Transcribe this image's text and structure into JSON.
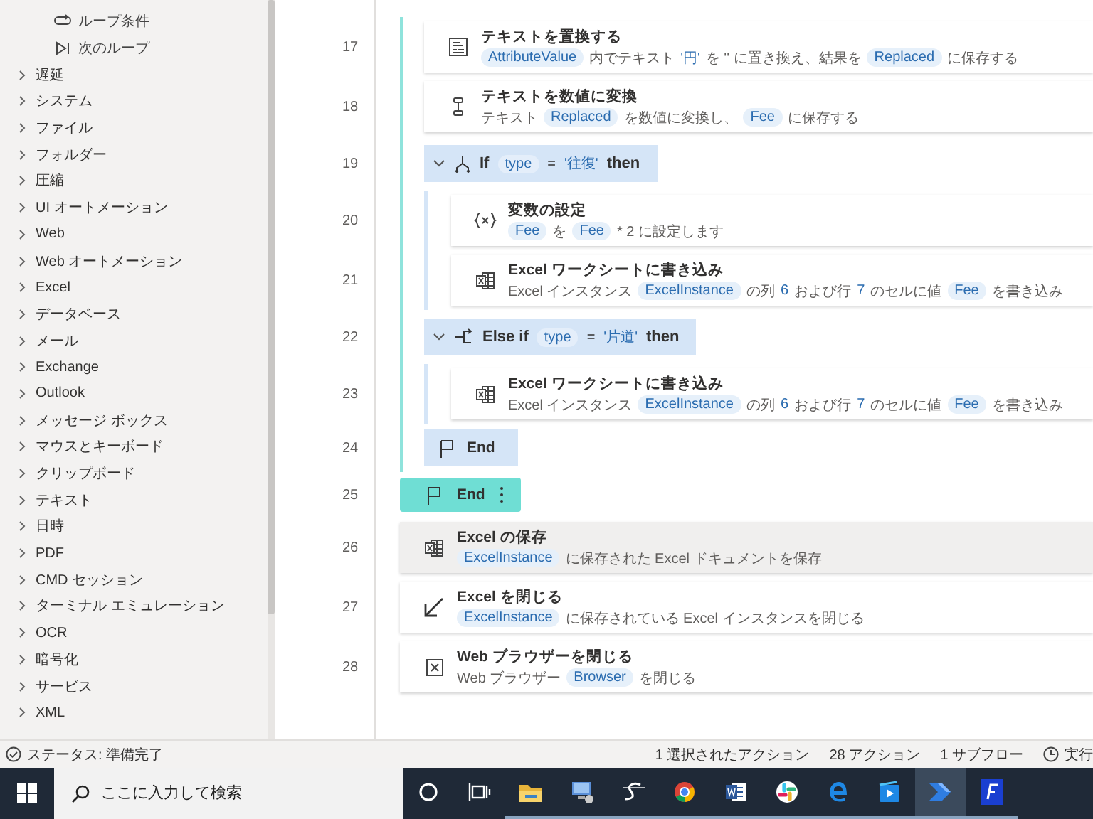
{
  "sidebar": {
    "items": [
      {
        "kind": "condition",
        "label": "ループ条件"
      },
      {
        "kind": "next",
        "label": "次のループ"
      },
      {
        "kind": "group",
        "label": "遅延",
        "expanded": false
      },
      {
        "kind": "group",
        "label": "システム",
        "expanded": false
      },
      {
        "kind": "group",
        "label": "ファイル",
        "expanded": false
      },
      {
        "kind": "group",
        "label": "フォルダー",
        "expanded": false
      },
      {
        "kind": "group",
        "label": "圧縮",
        "expanded": false
      },
      {
        "kind": "group",
        "label": "UI オートメーション",
        "expanded": false
      },
      {
        "kind": "group",
        "label": "Web",
        "expanded": false
      },
      {
        "kind": "group",
        "label": "Web オートメーション",
        "expanded": false
      },
      {
        "kind": "group",
        "label": "Excel",
        "expanded": false
      },
      {
        "kind": "group",
        "label": "データベース",
        "expanded": false
      },
      {
        "kind": "group",
        "label": "メール",
        "expanded": false
      },
      {
        "kind": "group",
        "label": "Exchange",
        "expanded": false
      },
      {
        "kind": "group",
        "label": "Outlook",
        "expanded": false
      },
      {
        "kind": "group",
        "label": "メッセージ ボックス",
        "expanded": false
      },
      {
        "kind": "group",
        "label": "マウスとキーボード",
        "expanded": false
      },
      {
        "kind": "group",
        "label": "クリップボード",
        "expanded": false
      },
      {
        "kind": "group",
        "label": "テキスト",
        "expanded": false
      },
      {
        "kind": "group",
        "label": "日時",
        "expanded": false
      },
      {
        "kind": "group",
        "label": "PDF",
        "expanded": false
      },
      {
        "kind": "group",
        "label": "CMD セッション",
        "expanded": false
      },
      {
        "kind": "group",
        "label": "ターミナル エミュレーション",
        "expanded": false
      },
      {
        "kind": "group",
        "label": "OCR",
        "expanded": false
      },
      {
        "kind": "group",
        "label": "暗号化",
        "expanded": false
      },
      {
        "kind": "group",
        "label": "サービス",
        "expanded": false
      },
      {
        "kind": "group",
        "label": "XML",
        "expanded": false
      }
    ]
  },
  "flow": {
    "steps": [
      {
        "kind": "loop",
        "children": [
          {
            "kind": "replace",
            "number": "17",
            "title": "テキストを置換する",
            "selected": false,
            "hovered": false,
            "description": [
              {
                "kind": "var",
                "text": "AttributeValue"
              },
              {
                "kind": "text",
                "text": "内でテキスト"
              },
              {
                "kind": "literal",
                "text": "'円'"
              },
              {
                "kind": "text",
                "text": "を '' に置き換え、結果を"
              },
              {
                "kind": "var",
                "text": "Replaced"
              },
              {
                "kind": "text",
                "text": "に保存する"
              }
            ]
          },
          {
            "kind": "convert",
            "number": "18",
            "title": "テキストを数値に変換",
            "selected": false,
            "hovered": false,
            "description": [
              {
                "kind": "text",
                "text": "テキスト"
              },
              {
                "kind": "var",
                "text": "Replaced"
              },
              {
                "kind": "text",
                "text": "を数値に変換し、"
              },
              {
                "kind": "var",
                "text": "Fee"
              },
              {
                "kind": "text",
                "text": "に保存する"
              }
            ]
          },
          {
            "kind": "if",
            "number": "19",
            "expanded": true,
            "selected": false,
            "header": [
              {
                "kind": "keyword",
                "text": "If"
              },
              {
                "kind": "var",
                "text": "type"
              },
              {
                "kind": "text",
                "text": "="
              },
              {
                "kind": "literal",
                "text": "'往復'"
              },
              {
                "kind": "keyword",
                "text": "then"
              }
            ],
            "children": [
              {
                "kind": "variable",
                "number": "20",
                "title": "変数の設定",
                "selected": false,
                "hovered": false,
                "description": [
                  {
                    "kind": "var",
                    "text": "Fee"
                  },
                  {
                    "kind": "text",
                    "text": "を"
                  },
                  {
                    "kind": "var",
                    "text": "Fee"
                  },
                  {
                    "kind": "text",
                    "text": "* 2 に設定します"
                  }
                ]
              },
              {
                "kind": "excel",
                "number": "21",
                "title": "Excel ワークシートに書き込み",
                "selected": false,
                "hovered": false,
                "description": [
                  {
                    "kind": "text",
                    "text": "Excel インスタンス"
                  },
                  {
                    "kind": "var",
                    "text": "ExcelInstance"
                  },
                  {
                    "kind": "text",
                    "text": "の列"
                  },
                  {
                    "kind": "literal",
                    "text": "6"
                  },
                  {
                    "kind": "text",
                    "text": "および行"
                  },
                  {
                    "kind": "literal",
                    "text": "7"
                  },
                  {
                    "kind": "text",
                    "text": "のセルに値"
                  },
                  {
                    "kind": "var",
                    "text": "Fee"
                  },
                  {
                    "kind": "text",
                    "text": "を書き込み"
                  }
                ]
              }
            ]
          },
          {
            "kind": "elseif",
            "number": "22",
            "expanded": true,
            "selected": false,
            "header": [
              {
                "kind": "keyword",
                "text": "Else if"
              },
              {
                "kind": "var",
                "text": "type"
              },
              {
                "kind": "text",
                "text": "="
              },
              {
                "kind": "literal",
                "text": "'片道'"
              },
              {
                "kind": "keyword",
                "text": "then"
              }
            ],
            "children": [
              {
                "kind": "excel",
                "number": "23",
                "title": "Excel ワークシートに書き込み",
                "selected": false,
                "hovered": false,
                "description": [
                  {
                    "kind": "text",
                    "text": "Excel インスタンス"
                  },
                  {
                    "kind": "var",
                    "text": "ExcelInstance"
                  },
                  {
                    "kind": "text",
                    "text": "の列"
                  },
                  {
                    "kind": "literal",
                    "text": "6"
                  },
                  {
                    "kind": "text",
                    "text": "および行"
                  },
                  {
                    "kind": "literal",
                    "text": "7"
                  },
                  {
                    "kind": "text",
                    "text": "のセルに値"
                  },
                  {
                    "kind": "var",
                    "text": "Fee"
                  },
                  {
                    "kind": "text",
                    "text": "を書き込み"
                  }
                ]
              }
            ]
          },
          {
            "kind": "end",
            "number": "24",
            "label": "End",
            "selected": false
          }
        ]
      },
      {
        "kind": "loop-end",
        "number": "25",
        "label": "End",
        "selected": true
      },
      {
        "kind": "excel",
        "number": "26",
        "title": "Excel の保存",
        "selected": false,
        "hovered": true,
        "description": [
          {
            "kind": "var",
            "text": "ExcelInstance"
          },
          {
            "kind": "text",
            "text": "に保存された Excel ドキュメントを保存"
          }
        ]
      },
      {
        "kind": "close-excel",
        "number": "27",
        "title": "Excel を閉じる",
        "selected": false,
        "hovered": false,
        "description": [
          {
            "kind": "var",
            "text": "ExcelInstance"
          },
          {
            "kind": "text",
            "text": "に保存されている Excel インスタンスを閉じる"
          }
        ]
      },
      {
        "kind": "close-browser",
        "number": "28",
        "title": "Web ブラウザーを閉じる",
        "selected": false,
        "hovered": false,
        "description": [
          {
            "kind": "text",
            "text": "Web ブラウザー"
          },
          {
            "kind": "var",
            "text": "Browser"
          },
          {
            "kind": "text",
            "text": "を閉じる"
          }
        ]
      }
    ]
  },
  "status_bar": {
    "status": "ステータス: 準備完了",
    "selected_actions": "1 選択されたアクション",
    "actions": "28 アクション",
    "subflows": "1 サブフロー",
    "run": "実行"
  },
  "taskbar": {
    "search": {
      "placeholder": "ここに入力して検索"
    },
    "apps": [
      {
        "kind": "cortana",
        "running": false,
        "active": false
      },
      {
        "kind": "taskview",
        "running": false,
        "active": false
      },
      {
        "kind": "folder",
        "running": true,
        "active": false
      },
      {
        "kind": "network",
        "running": true,
        "active": false
      },
      {
        "kind": "s",
        "running": true,
        "active": false
      },
      {
        "kind": "chrome",
        "running": true,
        "active": false
      },
      {
        "kind": "word",
        "running": true,
        "active": false
      },
      {
        "kind": "slack",
        "running": true,
        "active": false
      },
      {
        "kind": "edge",
        "running": true,
        "active": false
      },
      {
        "kind": "media",
        "running": true,
        "active": false
      },
      {
        "kind": "automate",
        "running": true,
        "active": true
      },
      {
        "kind": "f",
        "running": true,
        "active": false
      }
    ]
  }
}
